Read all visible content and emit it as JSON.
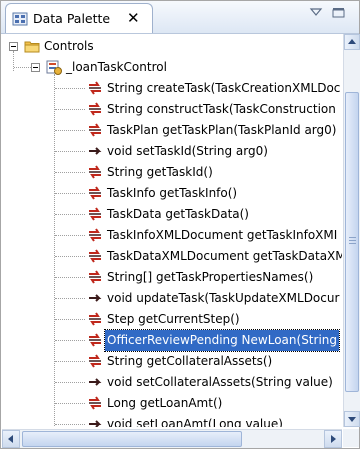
{
  "view": {
    "title": "Data Palette",
    "close_glyph": "✕",
    "icons": {
      "tab": "palette-view-icon",
      "view_menu": "view-menu-icon",
      "minimize": "minimize-icon"
    }
  },
  "tree": {
    "root": {
      "label": "Controls",
      "icon": "folder-icon"
    },
    "control": {
      "label": "_loanTaskControl",
      "icon": "control-icon"
    },
    "methods": [
      {
        "label": "String createTask(TaskCreationXMLDoc",
        "icon": "method-return-icon"
      },
      {
        "label": "String constructTask(TaskConstruction",
        "icon": "method-return-icon"
      },
      {
        "label": "TaskPlan getTaskPlan(TaskPlanId arg0)",
        "icon": "method-return-icon"
      },
      {
        "label": "void setTaskId(String arg0)",
        "icon": "method-void-icon"
      },
      {
        "label": "String getTaskId()",
        "icon": "method-return-icon"
      },
      {
        "label": "TaskInfo getTaskInfo()",
        "icon": "method-return-icon"
      },
      {
        "label": "TaskData getTaskData()",
        "icon": "method-return-icon"
      },
      {
        "label": "TaskInfoXMLDocument getTaskInfoXMI",
        "icon": "method-return-icon"
      },
      {
        "label": "TaskDataXMLDocument getTaskDataXM",
        "icon": "method-return-icon"
      },
      {
        "label": "String[] getTaskPropertiesNames()",
        "icon": "method-return-icon"
      },
      {
        "label": "void updateTask(TaskUpdateXMLDocur",
        "icon": "method-void-icon"
      },
      {
        "label": "Step getCurrentStep()",
        "icon": "method-return-icon"
      },
      {
        "label": "OfficerReviewPending NewLoan(String",
        "icon": "method-return-icon",
        "selected": true
      },
      {
        "label": "String getCollateralAssets()",
        "icon": "method-return-icon"
      },
      {
        "label": "void setCollateralAssets(String value)",
        "icon": "method-void-icon"
      },
      {
        "label": "Long getLoanAmt()",
        "icon": "method-return-icon"
      },
      {
        "label": "void setLoanAmt(Long value)",
        "icon": "method-void-icon"
      }
    ]
  },
  "scrollbars": {
    "up_icon": "scroll-up-arrow-icon",
    "down_icon": "scroll-down-arrow-icon",
    "left_icon": "scroll-left-arrow-icon",
    "right_icon": "scroll-right-arrow-icon"
  },
  "colors": {
    "selection": "#316ac5",
    "method_arrow_red": "#c0281c",
    "method_arrow_dark": "#3a1a1a",
    "folder": "#f2c04a"
  }
}
